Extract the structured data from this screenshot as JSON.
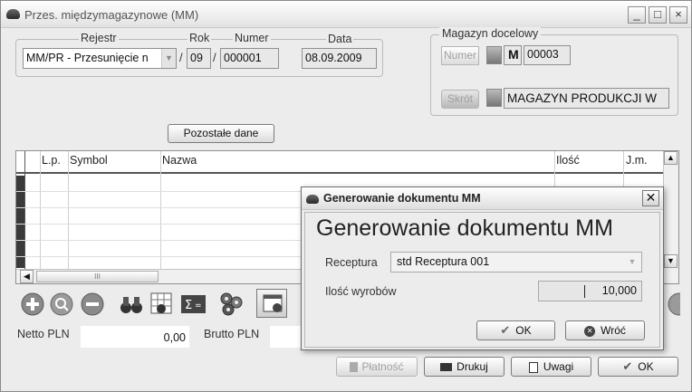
{
  "window": {
    "title": "Przes. międzymagazynowe (MM)",
    "controls": [
      "_",
      "□",
      "×"
    ]
  },
  "header": {
    "rejestr_label": "Rejestr",
    "rok_label": "Rok",
    "numer_label": "Numer",
    "data_label": "Data",
    "rejestr_value": "MM/PR  - Przesunięcie n",
    "rok_value": "09",
    "numer_value": "000001",
    "data_value": "08.09.2009",
    "separator": "/"
  },
  "magazyn": {
    "group_label": "Magazyn docelowy",
    "numer_button": "Numer",
    "prefix": "M",
    "numer_value": "00003",
    "skrot_button": "Skrót",
    "nazwa_value": "MAGAZYN PRODUKCJI W"
  },
  "pozostale_button": "Pozostałe dane",
  "table": {
    "columns": [
      "L.p.",
      "Symbol",
      "Nazwa",
      "Ilość",
      "J.m."
    ],
    "hscroll_thumb": "III"
  },
  "totals": {
    "netto_label": "Netto PLN",
    "netto_value": "0,00",
    "brutto_label": "Brutto PLN"
  },
  "bottom_buttons": {
    "platnosc": "Płatność",
    "drukuj": "Drukuj",
    "uwagi": "Uwagi",
    "ok": "OK"
  },
  "dialog": {
    "title": "Generowanie dokumentu  MM",
    "heading": "Generowanie dokumentu  MM",
    "receptura_label": "Receptura",
    "receptura_value": "std   Receptura 001",
    "ilosc_label": "Ilość  wyrobów",
    "ilosc_value": "10,000",
    "ok_button": "OK",
    "wroc_button": "Wróć"
  }
}
